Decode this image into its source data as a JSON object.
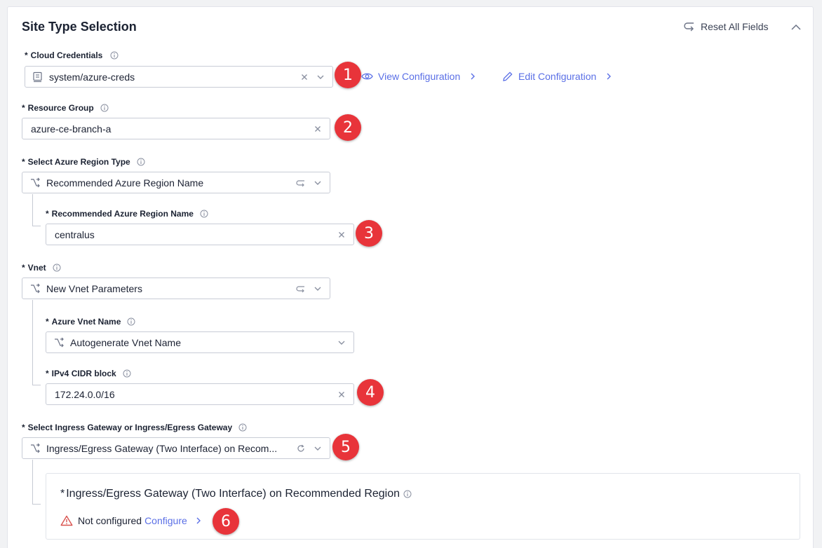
{
  "section": {
    "title": "Site Type Selection",
    "reset_label": "Reset All Fields"
  },
  "required_marker": "*",
  "cloud_credentials": {
    "label": "Cloud Credentials",
    "value": "system/azure-creds",
    "view_config": "View Configuration",
    "edit_config": "Edit Configuration",
    "badge": "1"
  },
  "resource_group": {
    "label": "Resource Group",
    "value": "azure-ce-branch-a",
    "badge": "2"
  },
  "region_type": {
    "label": "Select Azure Region Type",
    "value": "Recommended Azure Region Name"
  },
  "region_name": {
    "label": "Recommended Azure Region Name",
    "value": "centralus",
    "badge": "3"
  },
  "vnet": {
    "label": "Vnet",
    "value": "New Vnet Parameters"
  },
  "vnet_name": {
    "label": "Azure Vnet Name",
    "value": "Autogenerate Vnet Name"
  },
  "cidr": {
    "label": "IPv4 CIDR block",
    "value": "172.24.0.0/16",
    "badge": "4"
  },
  "gateway": {
    "label": "Select Ingress Gateway or Ingress/Egress Gateway",
    "value": "Ingress/Egress Gateway (Two Interface) on Recom...",
    "badge": "5"
  },
  "gateway_config": {
    "title": "Ingress/Egress Gateway (Two Interface) on Recommended Region",
    "status": "Not configured",
    "configure": "Configure",
    "badge": "6"
  },
  "colors": {
    "accent": "#5a6fe6",
    "badge": "#e8343a",
    "warning": "#d9534f",
    "text": "#1c2233",
    "border": "#c8ccd6"
  },
  "icons": {
    "reset": "reset-arrow-icon",
    "collapse": "chevron-up-icon",
    "info": "info-icon",
    "credential": "credential-list-icon",
    "clear": "close-icon",
    "dropdown": "chevron-down-icon",
    "view": "eye-icon",
    "edit": "pencil-icon",
    "choice": "branch-choice-icon",
    "swap": "swap-arrow-icon",
    "refresh": "refresh-icon",
    "warning": "warning-triangle-icon",
    "link_arrow": "chevron-right-icon"
  }
}
